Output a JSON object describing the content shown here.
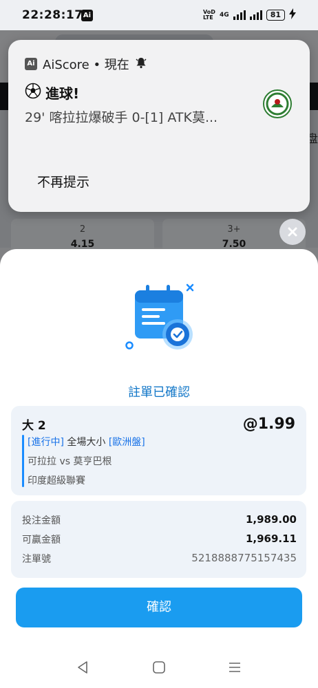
{
  "status_bar": {
    "time": "22:28:17",
    "app_badge": "Ai",
    "network": "VoD LTE",
    "signal_label": "4G",
    "battery": "81"
  },
  "background": {
    "cells": [
      {
        "label": "2",
        "value": "4.15"
      },
      {
        "label": "3+",
        "value": "7.50"
      }
    ],
    "side_glyph": "盘"
  },
  "notification": {
    "app_icon": "Ai",
    "app_line": "AiScore • 現在",
    "title": "進球!",
    "body": "29' 喀拉拉爆破手 0-[1] ATK莫...",
    "dismiss": "不再提示"
  },
  "sheet": {
    "title": "註單已確認",
    "bet": {
      "selection": "大 2",
      "odds": "@1.99",
      "status_tag": "[進行中]",
      "market": " 全場大小 ",
      "odds_type_tag": "[歐洲盤]",
      "match": "可拉拉 vs 莫亨巴根",
      "league": "印度超級聯賽"
    },
    "summary": {
      "stake_label": "投注金額",
      "stake_value": "1,989.00",
      "win_label": "可贏金額",
      "win_value": "1,969.11",
      "ticket_label": "注單號",
      "ticket_value": "5218888775157435"
    },
    "confirm_button": "確認"
  },
  "colors": {
    "accent": "#1a9cf0",
    "title_blue": "#1478c8",
    "tag_blue": "#1a73e8",
    "card_bg": "#eef3f9"
  }
}
